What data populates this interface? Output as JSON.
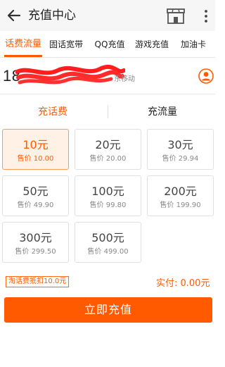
{
  "header": {
    "title": "充值中心",
    "back_icon": "back-arrow-icon",
    "store_icon": "store-icon",
    "more_icon": "more-vertical-icon"
  },
  "tabs": [
    {
      "label": "话费流量",
      "active": true
    },
    {
      "label": "固话宽带",
      "active": false
    },
    {
      "label": "QQ充值",
      "active": false
    },
    {
      "label": "游戏充值",
      "active": false
    },
    {
      "label": "加油卡",
      "active": false
    }
  ],
  "phone": {
    "number_visible": "18",
    "carrier": "东移动",
    "contact_icon": "contact-person-icon"
  },
  "subtabs": [
    {
      "label": "充话费",
      "active": true
    },
    {
      "label": "充流量",
      "active": false
    }
  ],
  "cards": [
    {
      "amount": "10元",
      "price": "售价 10.00",
      "selected": true
    },
    {
      "amount": "20元",
      "price": "售价 20.00",
      "selected": false
    },
    {
      "amount": "30元",
      "price": "售价 29.94",
      "selected": false
    },
    {
      "amount": "50元",
      "price": "售价 49.90",
      "selected": false
    },
    {
      "amount": "100元",
      "price": "售价 99.80",
      "selected": false
    },
    {
      "amount": "200元",
      "price": "售价 199.90",
      "selected": false
    },
    {
      "amount": "300元",
      "price": "售价 299.50",
      "selected": false
    },
    {
      "amount": "500元",
      "price": "售价 499.00",
      "selected": false
    }
  ],
  "footer": {
    "discount": "淘话费抵扣10.0元",
    "total": "实付: 0.00元",
    "submit": "立即充值"
  },
  "colors": {
    "accent": "#ff5a00",
    "selected_bg": "#fff1e6",
    "header_bg": "#f6f6f6"
  }
}
